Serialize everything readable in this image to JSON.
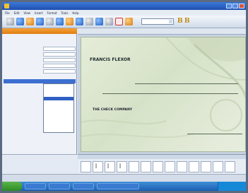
{
  "menubar": {
    "items": [
      "File",
      "Edit",
      "View",
      "Insert",
      "Format",
      "Tools",
      "Help"
    ]
  },
  "thumbs": {
    "glyphs": [
      "ꟾ",
      "ꟾ",
      "ꟾ",
      "ꟾ",
      "ꟾ"
    ]
  },
  "check": {
    "payer_name": "FRANCIS FLEXOR",
    "company": "THE CHECK COMPANY"
  },
  "colors": {
    "accent": "#e07d12",
    "selection": "#2f5fc4",
    "check_bg": "#d6e2c8"
  }
}
